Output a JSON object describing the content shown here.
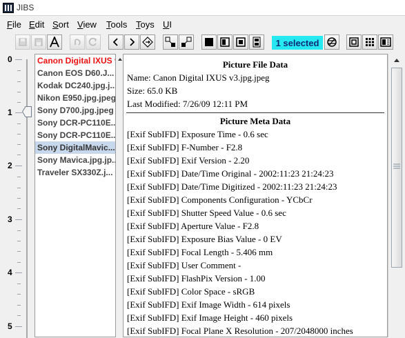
{
  "window": {
    "title": "JIBS"
  },
  "menu": [
    "File",
    "Edit",
    "Sort",
    "View",
    "Tools",
    "Toys",
    "UI"
  ],
  "toolbar": {
    "selected_badge": "1 selected"
  },
  "slider": {
    "ticks": [
      "0",
      "1",
      "2",
      "3",
      "4",
      "5"
    ],
    "value": 1
  },
  "files": [
    "Canon Digital IXUS v3.jpg.jpeg",
    "Canon EOS D60.J...",
    "Kodak DC240.jpg.j...",
    "Nikon E950.jpg.jpeg",
    "Sony D700.jpg.jpeg",
    "Sony DCR-PC110E...",
    "Sony DCR-PC110E...",
    "Sony DigitalMavic...",
    "Sony Mavica.jpg.jp...",
    "Traveler SX330Z.j..."
  ],
  "details": {
    "file_title": "Picture File Data",
    "name": "Name: Canon Digital IXUS v3.jpg.jpeg",
    "size": "Size: 65.0 KB",
    "modified": "Last Modified: 7/26/09 12:11 PM",
    "meta_title": "Picture Meta Data",
    "meta": [
      "[Exif SubIFD] Exposure Time - 0.6 sec",
      "[Exif SubIFD] F-Number - F2.8",
      "[Exif SubIFD] Exif Version - 2.20",
      "[Exif SubIFD] Date/Time Original - 2002:11:23 21:24:23",
      "[Exif SubIFD] Date/Time Digitized - 2002:11:23 21:24:23",
      "[Exif SubIFD] Components Configuration - YCbCr",
      "[Exif SubIFD] Shutter Speed Value - 0.6 sec",
      "[Exif SubIFD] Aperture Value - F2.8",
      "[Exif SubIFD] Exposure Bias Value - 0 EV",
      "[Exif SubIFD] Focal Length - 5.406 mm",
      "[Exif SubIFD] User Comment -",
      "[Exif SubIFD] FlashPix Version - 1.00",
      "[Exif SubIFD] Color Space - sRGB",
      "[Exif SubIFD] Exif Image Width - 614 pixels",
      "[Exif SubIFD] Exif Image Height - 460 pixels",
      "[Exif SubIFD] Focal Plane X Resolution - 207/2048000 inches"
    ]
  }
}
